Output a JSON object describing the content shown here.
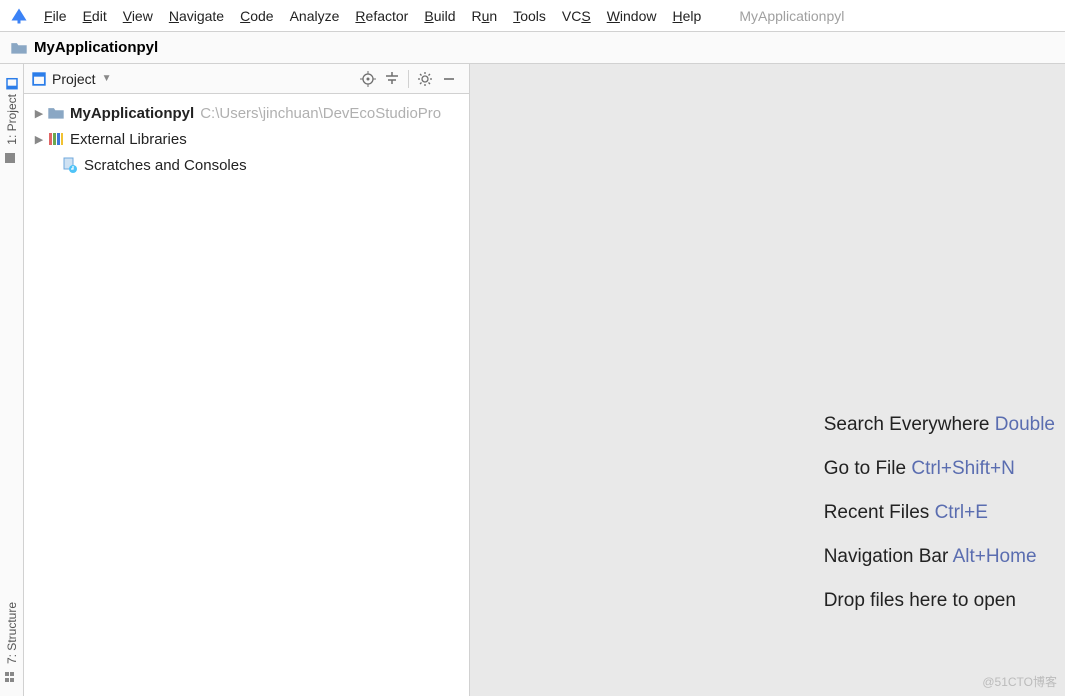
{
  "app": {
    "title": "MyApplicationpyl"
  },
  "menu": {
    "file": "File",
    "edit": "Edit",
    "view": "View",
    "navigate": "Navigate",
    "code": "Code",
    "analyze": "Analyze",
    "refactor": "Refactor",
    "build": "Build",
    "run": "Run",
    "tools": "Tools",
    "vcs": "VCS",
    "window": "Window",
    "help": "Help"
  },
  "breadcrumb": {
    "project": "MyApplicationpyl"
  },
  "gutter": {
    "project_tab": "1: Project",
    "structure_tab": "7: Structure"
  },
  "panel": {
    "title": "Project"
  },
  "tree": {
    "root": {
      "name": "MyApplicationpyl",
      "path": "C:\\Users\\jinchuan\\DevEcoStudioPro"
    },
    "ext_libs": "External Libraries",
    "scratches": "Scratches and Consoles"
  },
  "hints": {
    "search_label": "Search Everywhere ",
    "search_key": "Double",
    "goto_label": "Go to File ",
    "goto_key": "Ctrl+Shift+N",
    "recent_label": "Recent Files ",
    "recent_key": "Ctrl+E",
    "navbar_label": "Navigation Bar ",
    "navbar_key": "Alt+Home",
    "drop": "Drop files here to open"
  },
  "watermark": "@51CTO博客"
}
